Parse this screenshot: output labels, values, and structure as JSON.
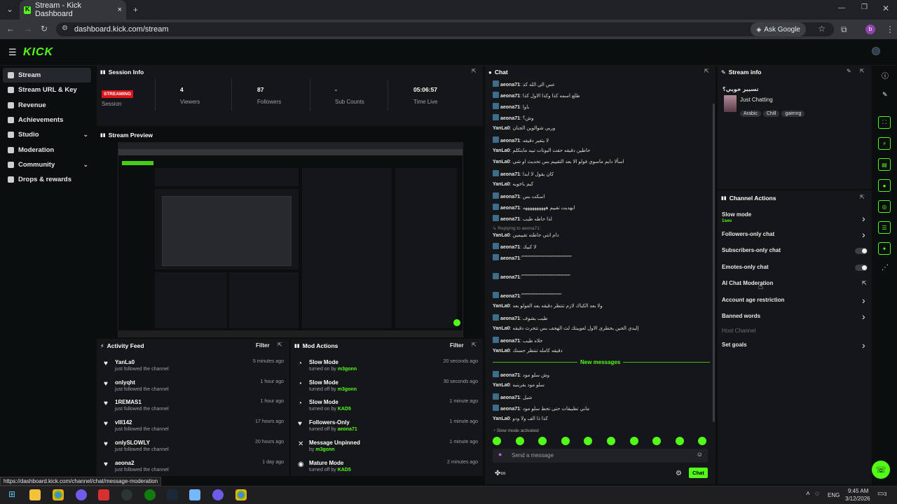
{
  "browser": {
    "tab_title": "Stream - Kick Dashboard",
    "url": "dashboard.kick.com/stream",
    "ask_google": "Ask Google",
    "profile": "b"
  },
  "app": {
    "logo": "KICK"
  },
  "sidebar": {
    "items": [
      {
        "label": "Stream",
        "icon": "video-icon",
        "active": true
      },
      {
        "label": "Stream URL & Key",
        "icon": "key-icon"
      },
      {
        "label": "Revenue",
        "icon": "revenue-icon"
      },
      {
        "label": "Achievements",
        "icon": "trophy-icon"
      },
      {
        "label": "Studio",
        "icon": "studio-icon",
        "chevron": true
      },
      {
        "label": "Moderation",
        "icon": "wrench-icon"
      },
      {
        "label": "Community",
        "icon": "community-icon",
        "chevron": true
      },
      {
        "label": "Drops & rewards",
        "icon": "gift-icon"
      }
    ]
  },
  "session": {
    "title": "Session Info",
    "status": "STREAMING",
    "status_label": "Session",
    "stats": [
      {
        "value": "4",
        "label": "Viewers"
      },
      {
        "value": "87",
        "label": "Followers"
      },
      {
        "value": "-",
        "label": "Sub Counts"
      },
      {
        "value": "05:06:57",
        "label": "Time Live"
      }
    ]
  },
  "preview": {
    "title": "Stream Preview"
  },
  "activity": {
    "title": "Activity Feed",
    "filter": "Filter",
    "items": [
      {
        "name": "YanLa0",
        "sub": "just followed the channel",
        "time": "5 minutes ago"
      },
      {
        "name": "onlyqht",
        "sub": "just followed the channel",
        "time": "1 hour ago"
      },
      {
        "name": "1REMAS1",
        "sub": "just followed the channel",
        "time": "1 hour ago"
      },
      {
        "name": "vlll142",
        "sub": "just followed the channel",
        "time": "17 hours ago"
      },
      {
        "name": "onlySLOWLY",
        "sub": "just followed the channel",
        "time": "20 hours ago"
      },
      {
        "name": "aeona2",
        "sub": "just followed the channel",
        "time": "1 day ago"
      }
    ]
  },
  "mod": {
    "title": "Mod Actions",
    "filter": "Filter",
    "items": [
      {
        "action": "Slow Mode",
        "desc": "turned on by",
        "by": "m3gonn",
        "time": "20 seconds ago"
      },
      {
        "action": "Slow Mode",
        "desc": "turned off by",
        "by": "m3gonn",
        "time": "30 seconds ago"
      },
      {
        "action": "Slow Mode",
        "desc": "turned on by",
        "by": "KAD5",
        "time": "1 minute ago"
      },
      {
        "action": "Followers-Only",
        "desc": "turned off by",
        "by": "aeona71",
        "time": "1 minute ago"
      },
      {
        "action": "Message Unpinned",
        "desc": "by",
        "by": "m3gonn",
        "time": "1 minute ago"
      },
      {
        "action": "Mature Mode",
        "desc": "turned off by",
        "by": "KAD5",
        "time": "2 minutes ago"
      }
    ]
  },
  "chat": {
    "title": "Chat",
    "new_messages": "New messages",
    "slow_mode": "Slow mode activated",
    "placeholder": "Send a message",
    "send": "Chat",
    "replying": "Replying to aeona71:",
    "messages": [
      {
        "user": "aeona71",
        "text": "عس الي الله كذ",
        "badge": true
      },
      {
        "user": "aeona71",
        "text": "طلع اسمه كذا وكذا الاول كذا",
        "badge": true
      },
      {
        "user": "aeona71",
        "text": "باوا",
        "badge": true
      },
      {
        "user": "aeona71",
        "text": "وش؟",
        "badge": true
      },
      {
        "user": "YanLa0",
        "text": "وربي شوالوين الجنان",
        "badge": false
      },
      {
        "user": "aeona71",
        "text": "لا يتغير دقيقه",
        "badge": true
      },
      {
        "user": "YanLa0",
        "text": "حاطين دقيقه حقت البوتات تبيد مابتكلم",
        "badge": false
      },
      {
        "user": "YanLa0",
        "text": "اسألا دايم ماسوي فولو الا بعد التقييم بس تحديث او شي",
        "badge": false
      },
      {
        "user": "aeona71",
        "text": "كان يقول لا ابدا",
        "badge": true
      },
      {
        "user": "YanLa0",
        "text": "كيم باخويه",
        "badge": false
      },
      {
        "user": "aeona71",
        "text": "اسكت بس",
        "badge": true
      },
      {
        "user": "aeona71",
        "text": "ابهديت تقييم ههههههههههه",
        "badge": true
      },
      {
        "user": "aeona71",
        "text": "لذا حاطه طيب",
        "badge": true
      },
      {
        "user": "YanLa0",
        "text": "دام انتي حاطته تقييمين",
        "badge": false
      },
      {
        "user": "aeona71",
        "text": "لا كبيك",
        "badge": true
      },
      {
        "user": "aeona71",
        "text": "ٌ ٌ ٌ ٌ ٌ ٌ ٌ ٌ ٌ ٌ ٌ ٌ ٌ ٌ ٌ ٌ ٌ ٌ ٌ ٌ ٌ ٌ ٌ ٌ ٌ ٌ ٌ ٌ ٌ ٌ ٌ ٌ ٌ ٌ ٌ",
        "badge": true
      },
      {
        "user": "aeona71",
        "text": "ٌ ٌ ٌ ٌ ٌ ٌ ٌ ٌ ٌ ٌ ٌ ٌ ٌ ٌ ٌ ٌ ٌ ٌ ٌ ٌ ٌ ٌ ٌ ٌ ٌ ٌ ٌ ٌ ٌ ٌ ٌ ٌ ٌ ٌ",
        "badge": true
      },
      {
        "user": "aeona71",
        "text": "ٌ ٌ ٌ ٌ ٌ ٌ ٌ ٌ ٌ ٌ ٌ ٌ ٌ ٌ ٌ ٌ ٌ ٌ ٌ ٌ ٌ ٌ ٌ ٌ ٌ ٌ ٌ ٌ",
        "badge": true
      },
      {
        "user": "YanLa0",
        "text": "ولا بعد الكباك لازم تنتظر دقيقه بعد الفولو بعد",
        "badge": false
      },
      {
        "user": "aeona71",
        "text": "طيب بشوف",
        "badge": true
      },
      {
        "user": "YanLa0",
        "text": "إليدي الحين بحطرى الاول لعويبتك لث الهجف بس تتحرث دقيقه",
        "badge": false
      },
      {
        "user": "aeona71",
        "text": "خلاه طيب",
        "badge": true
      },
      {
        "user": "YanLa0",
        "text": "دقيقه كامله تنتظر حسنك",
        "badge": false
      }
    ],
    "new": [
      {
        "user": "aeona71",
        "text": "وش سلو مود",
        "badge": true
      },
      {
        "user": "YanLa0",
        "text": "سلو مود بقربنيه",
        "badge": false
      },
      {
        "user": "aeona71",
        "text": "شيل",
        "badge": true
      },
      {
        "user": "aeona71",
        "text": "ماني تطبيقات حتى تحط سلو مود",
        "badge": true
      },
      {
        "user": "YanLa0",
        "text": "كذا ذا الف ولا ودو",
        "badge": false
      }
    ]
  },
  "streaminfo": {
    "title": "Stream info",
    "stream_title": "تسيير خويي؟",
    "category": "Just Chatting",
    "tags": [
      "Arabic",
      "Chill",
      "gaimng"
    ]
  },
  "actions": {
    "title": "Channel Actions",
    "items": [
      {
        "label": "Slow mode",
        "sub": "1sec",
        "type": "arrow"
      },
      {
        "label": "Followers-only chat",
        "type": "arrow"
      },
      {
        "label": "Subscribers-only chat",
        "type": "toggle"
      },
      {
        "label": "Emotes-only chat",
        "type": "toggle"
      },
      {
        "label": "AI Chat Moderation",
        "type": "external"
      },
      {
        "label": "Account age restriction",
        "type": "arrow"
      },
      {
        "label": "Banned words",
        "type": "arrow"
      },
      {
        "label": "Host Channel",
        "type": "disabled"
      },
      {
        "label": "Set goals",
        "type": "arrow"
      }
    ]
  },
  "status_url": "https://dashboard.kick.com/channel/chat/message-moderation",
  "taskbar": {
    "lang": "ENG",
    "time": "9:45 AM",
    "date": "3/12/2026",
    "notif": "3"
  }
}
